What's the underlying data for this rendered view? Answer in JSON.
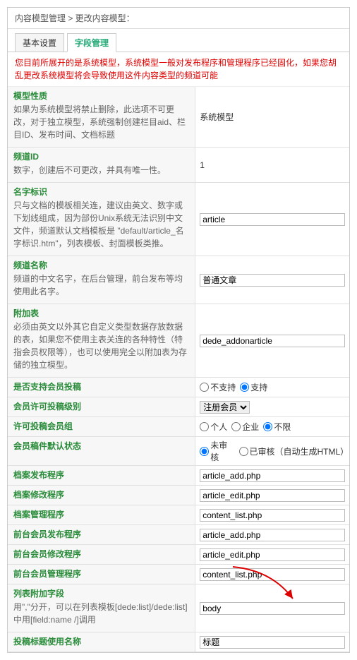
{
  "breadcrumb": "内容模型管理 > 更改内容模型：",
  "tabs": {
    "basic": "基本设置",
    "fields": "字段管理"
  },
  "warning": "您目前所展开的是系统模型，系统模型一般对发布程序和管理程序已经固化，如果您胡乱更改系统模型将会导致使用这件内容类型的频道可能",
  "rows": {
    "type": {
      "title": "模型性质",
      "desc": "如果为系统模型将禁止删除，此选项不可更改，对于独立模型，系统强制创建栏目aid、栏目ID、发布时间、文档标题",
      "value": "系统模型"
    },
    "cid": {
      "title": "频道ID",
      "desc": "数字，创建后不可更改，并具有唯一性。",
      "value": "1"
    },
    "name": {
      "title": "名字标识",
      "desc": "只与文档的模板相关连，建议由英文、数字或下划线组成，因为部份Unix系统无法识别中文文件，频道默认文档模板是 \"default/article_名字标识.htm\"，列表模板、封面模板类推。",
      "value": "article"
    },
    "chname": {
      "title": "频道名称",
      "desc": "频道的中文名字，在后台管理，前台发布等均使用此名字。",
      "value": "普通文章"
    },
    "addon": {
      "title": "附加表",
      "desc": "必须由英文以外其它自定义类型数据存放数据的表，如果您不使用主表关连的各种特性（特指会员权限等），也可以使用完全以附加表为存储的独立模型。",
      "value": "dede_addonarticle"
    },
    "member": {
      "title": "是否支持会员投稿",
      "opt1": "不支持",
      "opt2": "支持"
    },
    "memlv": {
      "title": "会员许可投稿级别",
      "value": "注册会员"
    },
    "memgrp": {
      "title": "许可投稿会员组",
      "opt1": "个人",
      "opt2": "企业",
      "opt3": "不限"
    },
    "status": {
      "title": "会员稿件默认状态",
      "opt1": "未审核",
      "opt2": "已审核（自动生成HTML）"
    },
    "pub": {
      "title": "档案发布程序",
      "value": "article_add.php"
    },
    "edit": {
      "title": "档案修改程序",
      "value": "article_edit.php"
    },
    "mng": {
      "title": "档案管理程序",
      "value": "content_list.php"
    },
    "fpub": {
      "title": "前台会员发布程序",
      "value": "article_add.php"
    },
    "fedit": {
      "title": "前台会员修改程序",
      "value": "article_edit.php"
    },
    "fmng": {
      "title": "前台会员管理程序",
      "value": "content_list.php"
    },
    "lstfld": {
      "title": "列表附加字段",
      "desc": "用\",\"分开，可以在列表模板[dede:list]/dede:list]中用[field:name /]调用",
      "value": "body"
    },
    "tplname": {
      "title": "投稿标题使用名称",
      "value": "标题"
    }
  }
}
